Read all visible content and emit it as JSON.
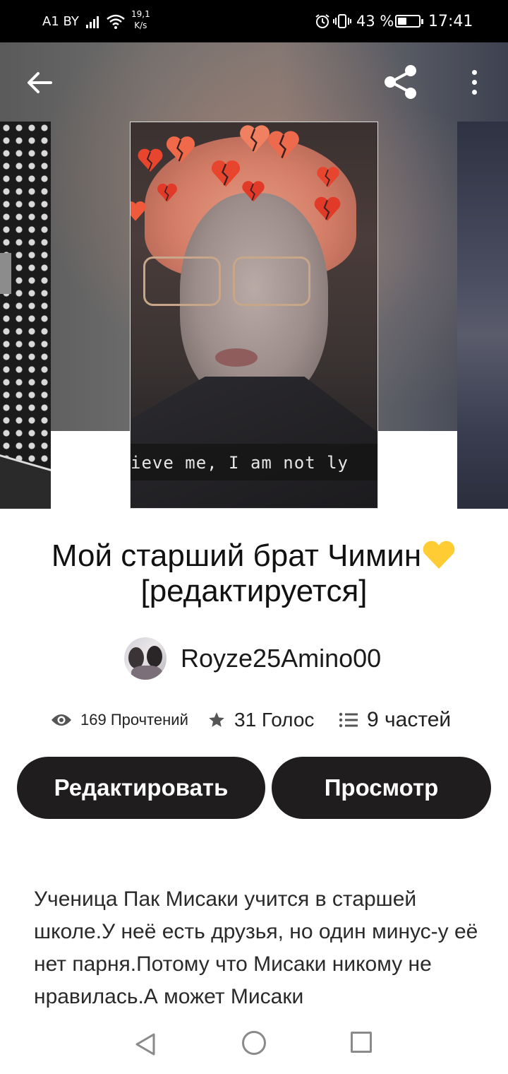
{
  "status_bar": {
    "carrier": "A1 BY",
    "speed_value": "19,1",
    "speed_unit": "K/s",
    "battery_percent": "43 %",
    "battery_level": 0.43,
    "time": "17:41"
  },
  "header": {
    "back_icon": "arrow-left-icon",
    "share_icon": "share-icon",
    "more_icon": "more-vertical-icon"
  },
  "cover": {
    "caption": "ieve me, I am not ly"
  },
  "story": {
    "title_line1": "Мой старший брат Чимин",
    "title_line2": "[редактируется]",
    "author": "Royze25Amino00",
    "reads": "169 Прочтений",
    "votes": "31 Голос",
    "parts": "9 частей",
    "description": "Ученица Пак Мисаки учится в старшей школе.У неё есть друзья, но один минус-у её нет парня.Потому что Мисаки никому не нравилась.А может Мисаки"
  },
  "actions": {
    "edit_label": "Редактировать",
    "view_label": "Просмотр"
  },
  "colors": {
    "button_bg": "#1f1d1e",
    "accent_heart": "#ffcc33"
  }
}
